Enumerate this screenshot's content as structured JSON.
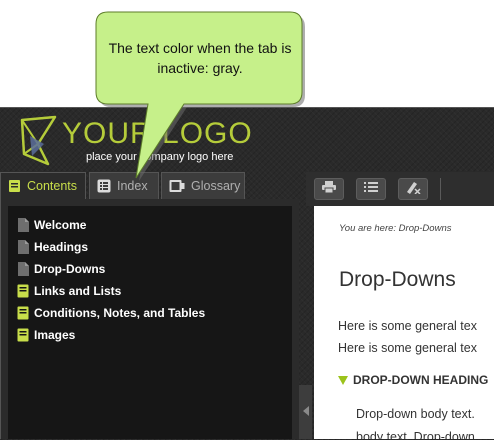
{
  "callout": {
    "text": "The text color when the tab is inactive: gray."
  },
  "logo": {
    "title": "YOUR LOGO",
    "tagline": "place your company logo here",
    "color": "#b5cc3a"
  },
  "tabs": [
    {
      "label": "Contents",
      "icon": "book-icon",
      "active": true
    },
    {
      "label": "Index",
      "icon": "list-icon",
      "active": false
    },
    {
      "label": "Glossary",
      "icon": "glossary-book-icon",
      "active": false
    }
  ],
  "nav": {
    "items": [
      {
        "label": "Welcome",
        "icon": "page-icon"
      },
      {
        "label": "Headings",
        "icon": "page-icon"
      },
      {
        "label": "Drop-Downs",
        "icon": "page-icon"
      },
      {
        "label": "Links and Lists",
        "icon": "book-icon"
      },
      {
        "label": "Conditions, Notes, and Tables",
        "icon": "book-icon"
      },
      {
        "label": "Images",
        "icon": "book-icon"
      }
    ]
  },
  "toolbar": {
    "buttons": [
      {
        "name": "print-button",
        "icon": "printer-icon"
      },
      {
        "name": "toc-button",
        "icon": "list-icon"
      },
      {
        "name": "remove-highlight-button",
        "icon": "highlighter-icon"
      }
    ]
  },
  "content": {
    "breadcrumb": "You are here: Drop-Downs",
    "heading": "Drop-Downs",
    "paragraph_1": "Here is some general tex",
    "paragraph_2": "Here is some general tex",
    "dropdown_heading": "DROP-DOWN HEADING",
    "dropdown_body_1": "Drop-down body text.",
    "dropdown_body_2": "body text. Drop-down"
  },
  "colors": {
    "accent": "#c8de4a",
    "inactive_tab_text": "#b0b0b0",
    "callout_fill": "#c6f08a"
  }
}
